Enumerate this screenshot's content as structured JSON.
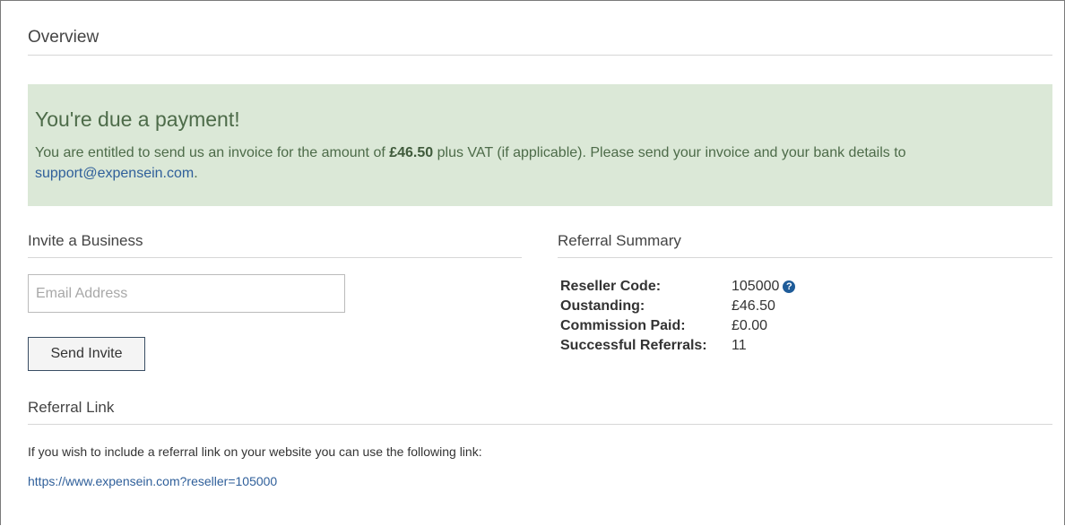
{
  "overview": {
    "title": "Overview"
  },
  "alert": {
    "title": "You're due a payment!",
    "text_before": "You are entitled to send us an invoice for the amount of ",
    "amount": "£46.50",
    "text_after": " plus VAT (if applicable). Please send your invoice and your bank details to ",
    "email": "support@expensein.com",
    "text_end": "."
  },
  "invite": {
    "title": "Invite a Business",
    "email_placeholder": "Email Address",
    "email_value": "",
    "send_label": "Send Invite"
  },
  "summary": {
    "title": "Referral Summary",
    "rows": [
      {
        "label": "Reseller Code:",
        "value": "105000"
      },
      {
        "label": "Oustanding:",
        "value": "£46.50"
      },
      {
        "label": "Commission Paid:",
        "value": "£0.00"
      },
      {
        "label": "Successful Referrals:",
        "value": "11"
      }
    ],
    "help_icon": "question-circle-icon"
  },
  "referral": {
    "title": "Referral Link",
    "text": "If you wish to include a referral link on your website you can use the following link:",
    "link": "https://www.expensein.com?reseller=105000"
  },
  "colors": {
    "alert_bg": "#dbe8d7",
    "alert_text": "#4d6b49",
    "link": "#2f5f9a",
    "help_icon": "#1f5c99"
  }
}
